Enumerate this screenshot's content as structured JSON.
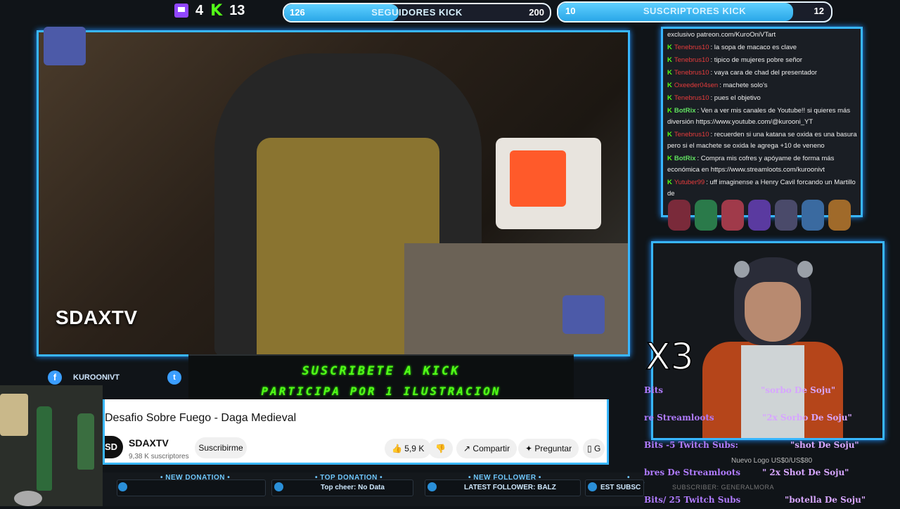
{
  "top": {
    "twitch_count": "4",
    "kick_count": "13",
    "goal_followers": {
      "label": "SEGUIDORES KICK",
      "start": "126",
      "end": "200",
      "progress": 0.43
    },
    "goal_subs": {
      "label": "SUSCRIPTORES KICK",
      "start": "10",
      "end": "12",
      "progress": 0.86
    }
  },
  "video": {
    "watermark": "SDAXTV"
  },
  "chat": {
    "lines": [
      {
        "user": "",
        "text": "exclusivo patreon.com/KuroOniVTart",
        "bot": false
      },
      {
        "user": "Tenebrus10",
        "text": ": la sopa de macaco es clave",
        "bot": false
      },
      {
        "user": "Tenebrus10",
        "text": ": tipico de mujeres pobre señor",
        "bot": false
      },
      {
        "user": "Tenebrus10",
        "text": ": vaya cara de chad del presentador",
        "bot": false
      },
      {
        "user": "Oxeeder04sen",
        "text": ": machete solo's",
        "bot": false
      },
      {
        "user": "Tenebrus10",
        "text": ": pues el objetivo",
        "bot": false
      },
      {
        "user": "BotRix",
        "text": ": Ven a ver mis canales de Youtube!! si quieres más diversión https://www.youtube.com/@kurooni_YT",
        "bot": true
      },
      {
        "user": "Tenebrus10",
        "text": ": recuerden si una katana se oxida es una basura pero si el machete se oxida le agrega +10 de veneno",
        "bot": false
      },
      {
        "user": "BotRix",
        "text": ": Compra mis cofres y apóyame de forma más económica en https://www.streamloots.com/kuroonivt",
        "bot": true
      },
      {
        "user": "Yutuber99",
        "text": ": uff imaginense a Henry Cavil forcando un Martillo de",
        "bot": false
      }
    ]
  },
  "overlay": {
    "multiplier": "X3"
  },
  "rewards": [
    {
      "left": "Bits",
      "right": "\"sorbo De Soju\""
    },
    {
      "left": "re Streamloots",
      "right": "\"2x Sorbo De Soju\""
    },
    {
      "left": "Bits -5 Twitch Subs:",
      "right": "\"shot De Soju\""
    },
    {
      "left": "bres De Streamloots",
      "right": "\" 2x Shot De Soju\""
    },
    {
      "left": "Bits/ 25 Twitch Subs",
      "right": "\"botella De Soju\""
    }
  ],
  "rewards_extra": {
    "logo": "Nuevo Logo US$0/US$80",
    "subs": "SUBSCRIBER: GENERALMORA"
  },
  "social": {
    "facebook": "KUROONIVT"
  },
  "banner": {
    "line1": "SUSCRIBETE A KICK",
    "line2": "PARTICIPA POR 1 ILUSTRACION"
  },
  "youtube": {
    "title": "Desafio Sobre Fuego - Daga Medieval",
    "channel": "SDAXTV",
    "avatar": "SD",
    "subs": "9,38 K suscriptores",
    "subscribe": "Suscribirme",
    "likes": "5,9 K",
    "share": "Compartir",
    "ask": "Preguntar",
    "more": "G"
  },
  "alerts": {
    "new_donation": "• NEW DONATION •",
    "top_donation": "• TOP DONATION •",
    "top_donation_val": "Top cheer: No Data",
    "new_follower": "• NEW FOLLOWER •",
    "new_follower_val": "LATEST FOLLOWER: BALZ",
    "new_sub": "• NEW",
    "new_sub_val": "EST SUBSC"
  },
  "colors": {
    "accent": "#38b6ff",
    "kick": "#53fc18",
    "twitch": "#9146ff"
  }
}
